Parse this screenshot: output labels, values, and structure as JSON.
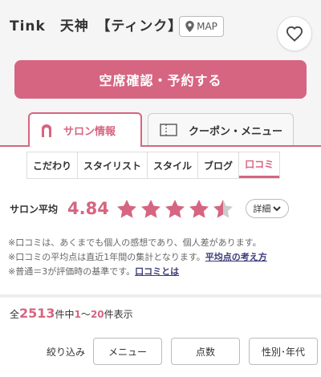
{
  "header": {
    "salon_name": "Tink　天神　【ティンク】",
    "map_label": "MAP",
    "favorite_icon": "heart-outline-icon"
  },
  "reserve_button_label": "空席確認・予約する",
  "tabs": [
    {
      "label": "サロン情報",
      "icon": "salon-icon",
      "active": true
    },
    {
      "label": "クーポン・メニュー",
      "icon": "coupon-icon",
      "active": false
    }
  ],
  "sub_nav": [
    {
      "label": "こだわり",
      "active": false
    },
    {
      "label": "スタイリスト",
      "active": false
    },
    {
      "label": "スタイル",
      "active": false
    },
    {
      "label": "ブログ",
      "active": false
    },
    {
      "label": "口コミ",
      "active": true
    }
  ],
  "rating": {
    "label": "サロン平均",
    "value": "4.84",
    "stars_filled": 4.5,
    "stars_total": 5,
    "detail_label": "詳細"
  },
  "notes": {
    "line1": "※口コミは、あくまでも個人の感想であり、個人差があります。",
    "line2": "※口コミの平均点は直近1年間の集計となります。",
    "line2_link": "平均点の考え方",
    "line3": "※普通＝3が評価時の基準です。",
    "line3_link": "口コミとは"
  },
  "count": {
    "prefix": "全",
    "total": "2513",
    "mid": "件中",
    "range_start": "1",
    "tilde": "～",
    "range_end": "20",
    "suffix": "件表示"
  },
  "filter": {
    "label": "絞り込み",
    "buttons": [
      "メニュー",
      "点数",
      "性別･年代"
    ]
  },
  "colors": {
    "accent": "#d66581",
    "link": "#3a3a7a"
  }
}
